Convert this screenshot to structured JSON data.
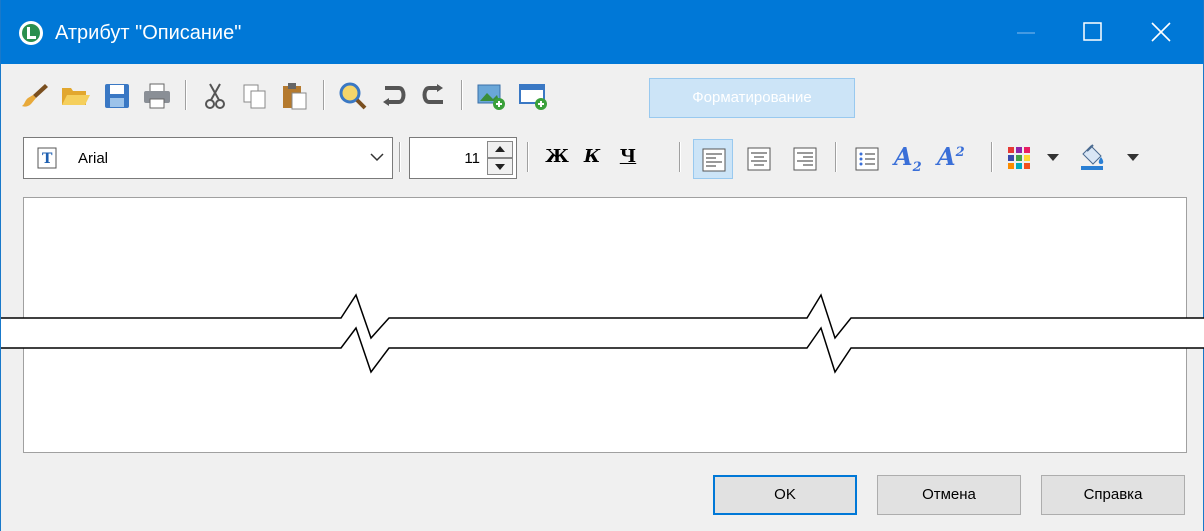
{
  "window": {
    "title": "Атрибут \"Описание\"",
    "accent_color": "#0078d7"
  },
  "toolbar1": {
    "icons": [
      "brush-icon",
      "open-folder-icon",
      "save-icon",
      "print-icon",
      "cut-icon",
      "copy-icon",
      "paste-icon",
      "find-icon",
      "undo-icon",
      "redo-icon",
      "insert-image-icon",
      "insert-object-icon"
    ],
    "format_button_label": "Форматирование"
  },
  "toolbar2": {
    "font_family": "Arial",
    "font_size": "11",
    "bold_label": "Ж",
    "italic_label": "К",
    "underline_label": "Ч",
    "subscript_label": "A",
    "subscript_mark": "2",
    "superscript_label": "A",
    "superscript_mark": "2",
    "active_alignment": "left"
  },
  "editor": {
    "content": ""
  },
  "buttons": {
    "ok": "OK",
    "cancel": "Отмена",
    "help": "Справка"
  }
}
